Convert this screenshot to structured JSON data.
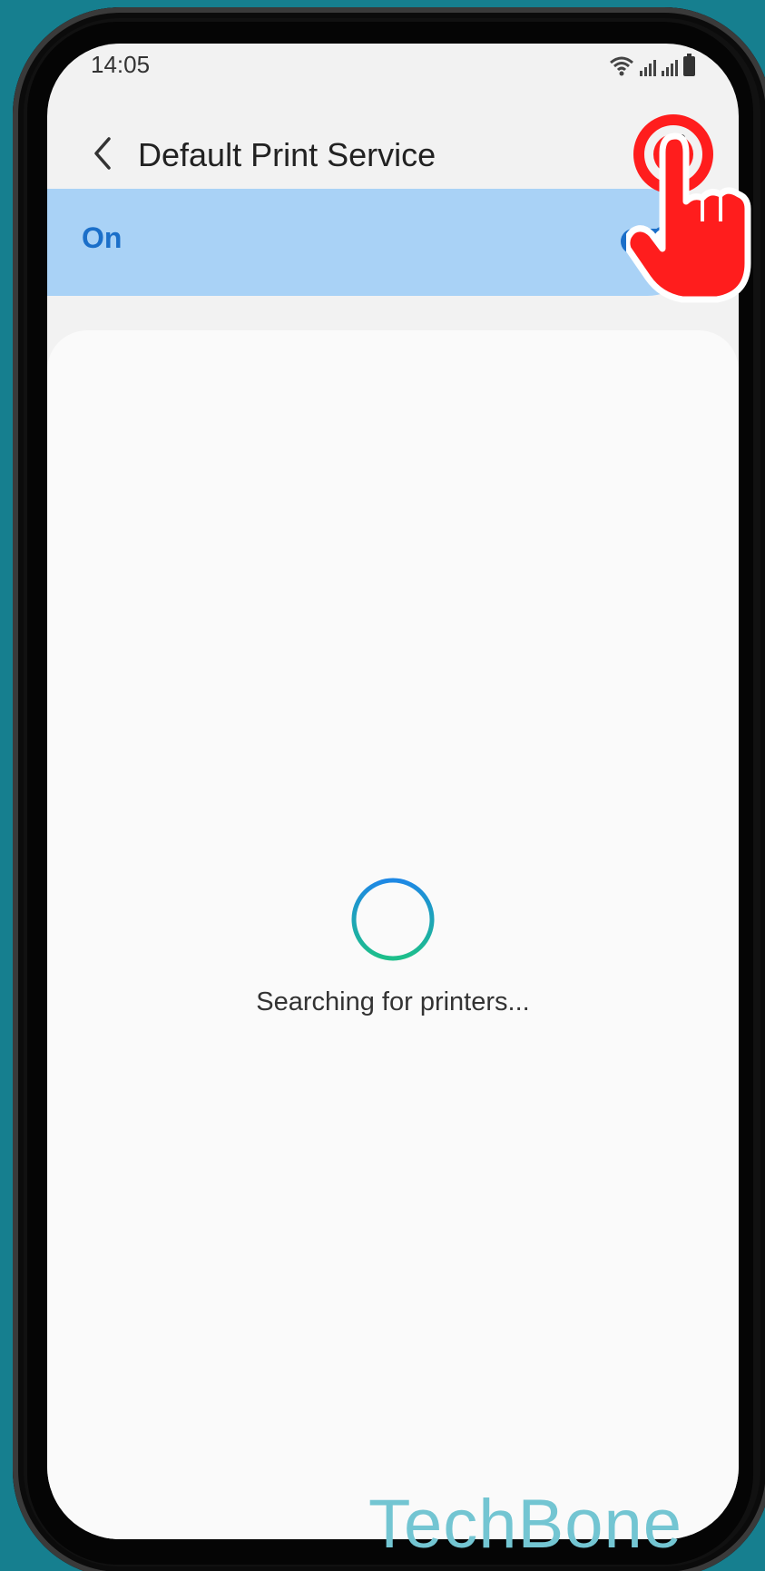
{
  "status_bar": {
    "time": "14:05"
  },
  "app_bar": {
    "title": "Default Print Service",
    "back_icon": "chevron-left-icon",
    "more_icon": "more-vert-icon"
  },
  "toggle": {
    "label": "On",
    "state": true
  },
  "content": {
    "status_text": "Searching for printers..."
  },
  "watermark": "TechBone",
  "colors": {
    "accent": "#1b6fc9",
    "toggle_bg": "#a9d2f6",
    "tap_highlight": "#ff1d1d",
    "watermark": "#73c5d2"
  }
}
